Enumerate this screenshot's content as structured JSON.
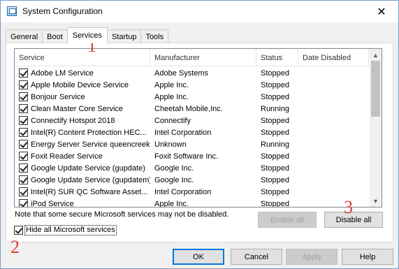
{
  "window": {
    "title": "System Configuration"
  },
  "tabs": [
    {
      "label": "General",
      "active": false
    },
    {
      "label": "Boot",
      "active": false
    },
    {
      "label": "Services",
      "active": true
    },
    {
      "label": "Startup",
      "active": false
    },
    {
      "label": "Tools",
      "active": false
    }
  ],
  "columns": {
    "service": "Service",
    "manufacturer": "Manufacturer",
    "status": "Status",
    "date_disabled": "Date Disabled"
  },
  "services": [
    {
      "name": "Adobe LM Service",
      "manufacturer": "Adobe Systems",
      "status": "Stopped",
      "date_disabled": "",
      "checked": true
    },
    {
      "name": "Apple Mobile Device Service",
      "manufacturer": "Apple Inc.",
      "status": "Stopped",
      "date_disabled": "",
      "checked": true
    },
    {
      "name": "Bonjour Service",
      "manufacturer": "Apple Inc.",
      "status": "Stopped",
      "date_disabled": "",
      "checked": true
    },
    {
      "name": "Clean Master Core Service",
      "manufacturer": "Cheetah Mobile,Inc.",
      "status": "Running",
      "date_disabled": "",
      "checked": true
    },
    {
      "name": "Connectify Hotspot 2018",
      "manufacturer": "Connectify",
      "status": "Stopped",
      "date_disabled": "",
      "checked": true
    },
    {
      "name": "Intel(R) Content Protection HEC...",
      "manufacturer": "Intel Corporation",
      "status": "Stopped",
      "date_disabled": "",
      "checked": true
    },
    {
      "name": "Energy Server Service queencreek",
      "manufacturer": "Unknown",
      "status": "Running",
      "date_disabled": "",
      "checked": true
    },
    {
      "name": "Foxit Reader Service",
      "manufacturer": "Foxit Software Inc.",
      "status": "Stopped",
      "date_disabled": "",
      "checked": true
    },
    {
      "name": "Google Update Service (gupdate)",
      "manufacturer": "Google Inc.",
      "status": "Stopped",
      "date_disabled": "",
      "checked": true
    },
    {
      "name": "Google Update Service (gupdatem)",
      "manufacturer": "Google Inc.",
      "status": "Stopped",
      "date_disabled": "",
      "checked": true
    },
    {
      "name": "Intel(R) SUR QC Software Asset...",
      "manufacturer": "Intel Corporation",
      "status": "Stopped",
      "date_disabled": "",
      "checked": true
    },
    {
      "name": "iPod Service",
      "manufacturer": "Apple Inc.",
      "status": "Stopped",
      "date_disabled": "",
      "checked": true
    }
  ],
  "note": "Note that some secure Microsoft services may not be disabled.",
  "buttons": {
    "enable_all": "Enable all",
    "disable_all": "Disable all",
    "ok": "OK",
    "cancel": "Cancel",
    "apply": "Apply",
    "help": "Help"
  },
  "hide_ms": {
    "label": "Hide all Microsoft services",
    "checked": true
  },
  "annotations": {
    "a1": "1",
    "a2": "2",
    "a3": "3"
  },
  "colors": {
    "annotation": "#e53935",
    "default_button_border": "#0078d7"
  },
  "icons": {
    "app": "msconfig-icon",
    "close": "close-icon",
    "scroll_up": "chevron-up-icon",
    "scroll_down": "chevron-down-icon"
  }
}
